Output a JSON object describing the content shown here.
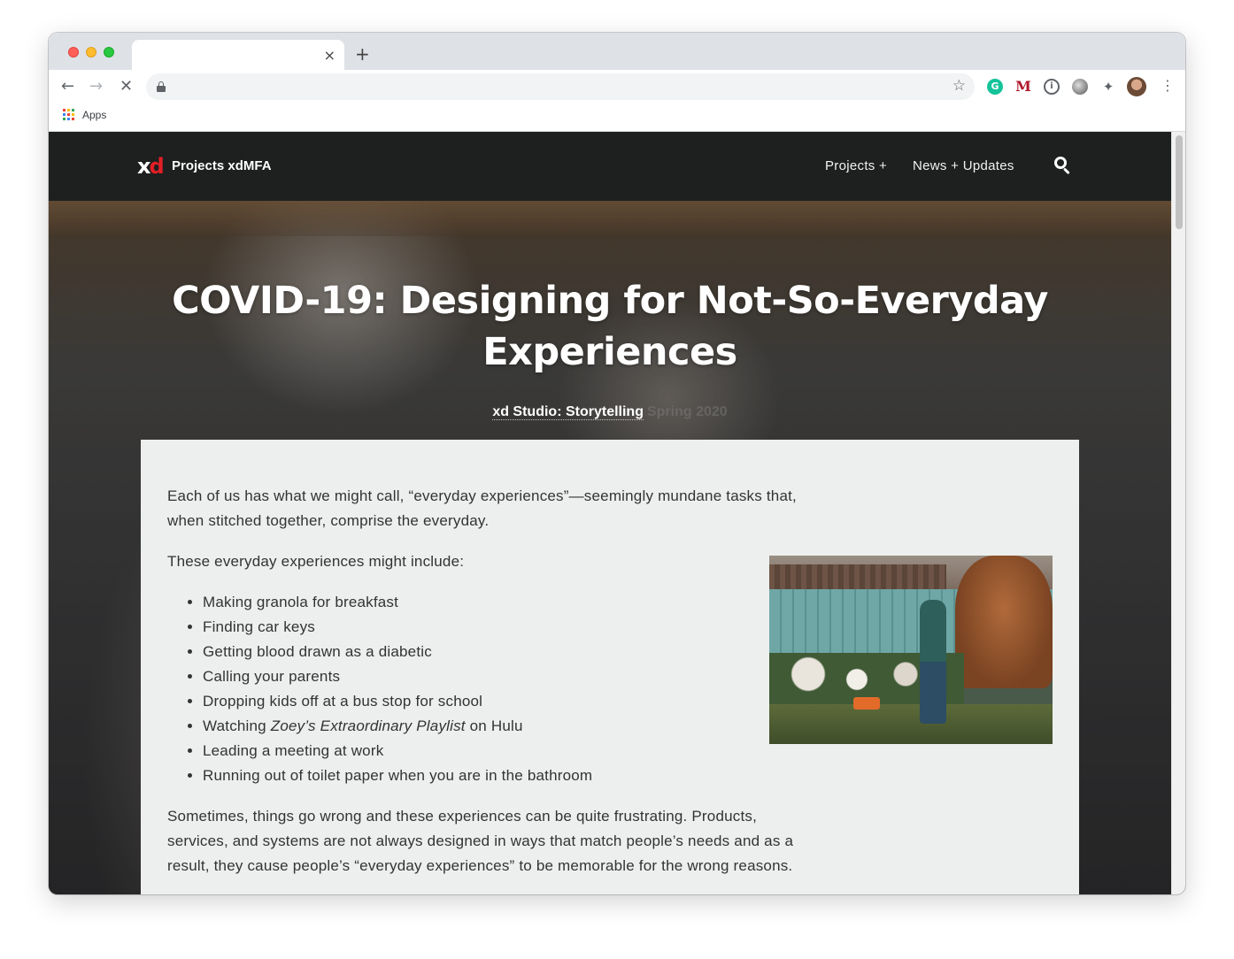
{
  "browser": {
    "tab_close": "×",
    "new_tab": "+",
    "back": "←",
    "forward": "→",
    "reload": "✕",
    "star": "☆",
    "menu": "⋮",
    "extensions": {
      "grammarly": "G",
      "m_ext": "M",
      "info_ext": "i",
      "puzzle": "✦"
    },
    "bookmarks": {
      "apps_label": "Apps",
      "apps_colors": [
        "#ea4335",
        "#fbbc04",
        "#34a853",
        "#4285f4",
        "#ea4335",
        "#fbbc04",
        "#34a853",
        "#4285f4",
        "#ea4335"
      ]
    }
  },
  "site": {
    "logo_x": "x",
    "logo_d": "d",
    "title": "Projects xdMFA",
    "nav": {
      "projects": "Projects +",
      "news": "News + Updates"
    },
    "accent_color": "#e21f26",
    "header_color": "#1e1f1f"
  },
  "hero": {
    "title": "COVID-19: Designing for Not-So-Everyday Experiences",
    "studio": "xd Studio: Storytelling",
    "term": "Spring 2020"
  },
  "article": {
    "intro": "Each of us has what we might call, “everyday experiences”—seemingly mundane tasks that, when stitched together, comprise the everyday.",
    "lead_in": "These everyday experiences might include:",
    "items": [
      "Making granola for breakfast",
      "Finding car keys",
      "Getting blood drawn as a diabetic",
      "Calling your parents",
      "Dropping kids off at a bus stop for school"
    ],
    "watching_prefix": "Watching ",
    "watching_title": "Zoey’s Extraordinary Playlist",
    "watching_suffix": " on Hulu",
    "items_after": [
      "Leading a meeting at work",
      "Running out of toilet paper when you are in the bathroom"
    ],
    "after": "Sometimes, things go wrong and these experiences can be quite frustrating. Products, services, and systems are not always designed in ways that match people’s needs and as a result, they cause people’s “everyday experiences” to be memorable for the wrong reasons."
  }
}
